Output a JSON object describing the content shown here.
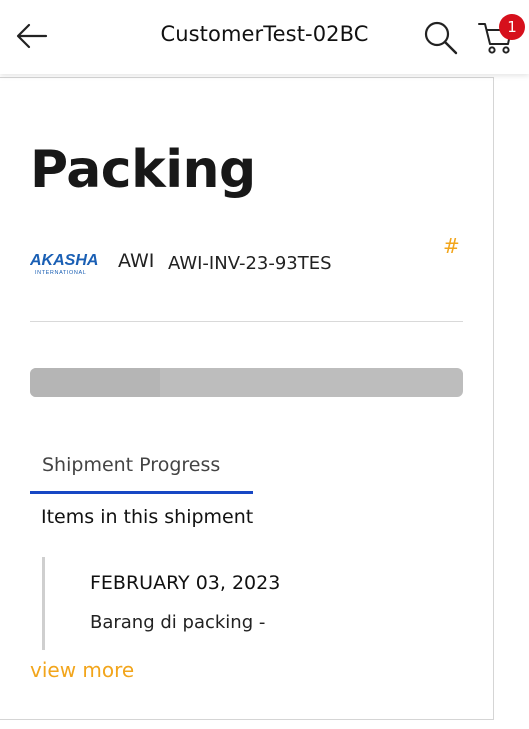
{
  "header": {
    "title": "CustomerTest-02BC",
    "back_icon": "arrow-left-icon",
    "search_icon": "search-icon",
    "cart_icon": "cart-icon",
    "cart_count": "1"
  },
  "page": {
    "heading": "Packing",
    "logo_text": "AKASHA",
    "logo_subtext": "INTERNATIONAL",
    "carrier": "AWI",
    "invoice_number": "AWI-INV-23-93TES",
    "hash_label": "#",
    "progress_fraction": 0.3
  },
  "tabs": [
    {
      "label": "Shipment Progress",
      "active": true
    }
  ],
  "shipment": {
    "section_title": "Items in this shipment",
    "events": [
      {
        "date": "FEBRUARY 03, 2023",
        "description": "Barang di packing -"
      }
    ],
    "view_more_label": "view more"
  },
  "colors": {
    "accent": "#f2a51b",
    "tab_active": "#1747c4",
    "badge": "#d6101c",
    "logo_blue": "#1a5fb4"
  }
}
